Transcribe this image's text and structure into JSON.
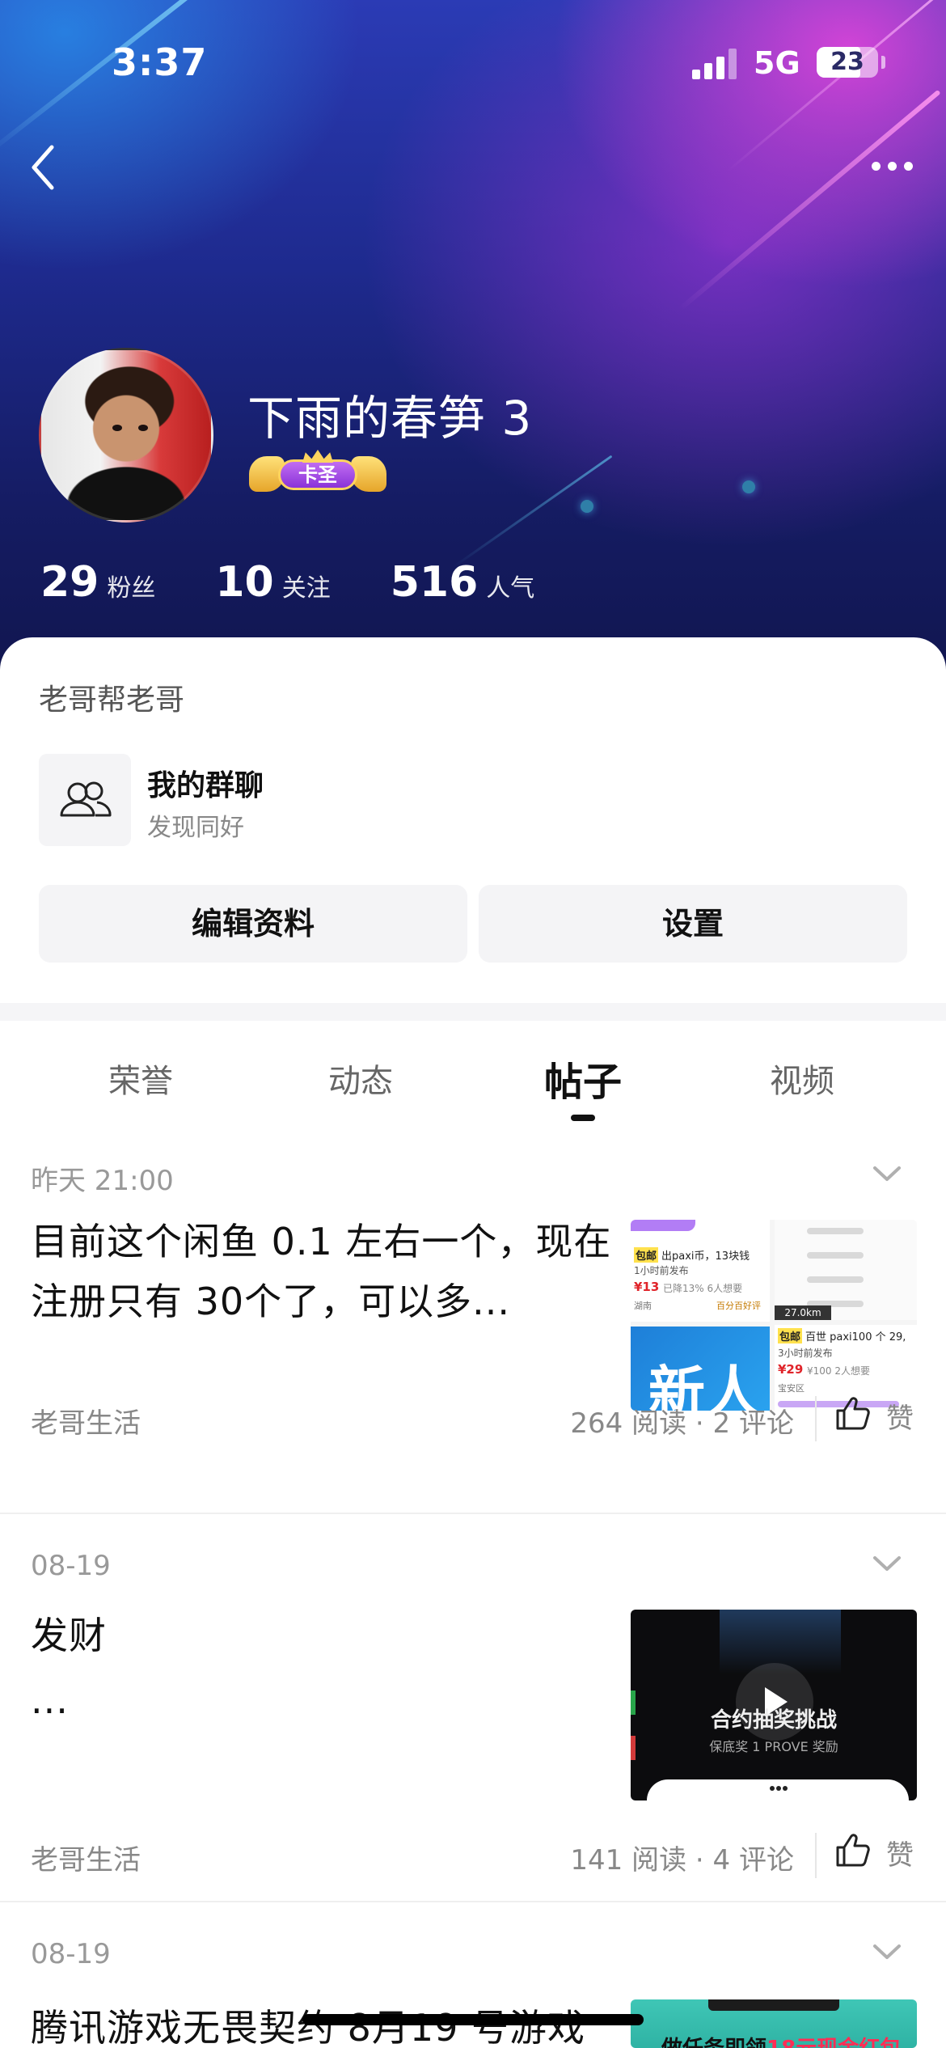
{
  "status_bar": {
    "time": "3:37",
    "network": "5G",
    "battery": "23"
  },
  "header": {
    "username": "下雨的春笋 3",
    "level_badge": "卡圣",
    "stats": [
      {
        "value": "29",
        "label": "粉丝"
      },
      {
        "value": "10",
        "label": "关注"
      },
      {
        "value": "516",
        "label": "人气"
      }
    ]
  },
  "profile": {
    "bio": "老哥帮老哥",
    "group": {
      "title": "我的群聊",
      "subtitle": "发现同好"
    },
    "buttons": {
      "edit": "编辑资料",
      "settings": "设置"
    }
  },
  "tabs": [
    {
      "label": "荣誉",
      "active": false
    },
    {
      "label": "动态",
      "active": false
    },
    {
      "label": "帖子",
      "active": true
    },
    {
      "label": "视频",
      "active": false
    }
  ],
  "posts": [
    {
      "date": "昨天 21:00",
      "title": "目前这个闲鱼 0.1 左右一个，现在注册只有 30个了，可以多...",
      "forum": "老哥生活",
      "meta": "264 阅读 · 2 评论",
      "like_label": "赞",
      "thumb": {
        "l1": "包邮",
        "l1b": "出paxi币，13块钱",
        "l2": "1小时前发布",
        "p1": "¥13",
        "p1b": "已降13%  6人想要",
        "loc1": "湖南",
        "tag1": "百分百好评",
        "l3": "包邮",
        "l3b": "百世 paxi100 个 29,",
        "l4": "3小时前发布",
        "p2": "¥29",
        "p2b": "¥100  2人想要",
        "loc2": "宝安区",
        "dur": "27.0km",
        "new_label": "新人"
      }
    },
    {
      "date": "08-19",
      "title": "发财\n...",
      "forum": "老哥生活",
      "meta": "141 阅读 · 4 评论",
      "like_label": "赞",
      "thumb": {
        "cap1": "合约抽奖挑战",
        "cap2": "保底奖 1 PROVE 奖励"
      }
    },
    {
      "date": "08-19",
      "title": "腾讯游戏无畏契约 8月19 号游戏",
      "thumb": {
        "text_a": "做任务即领",
        "text_b": "18元现金红包"
      }
    }
  ],
  "colors": {
    "accent": "#111111",
    "banner_top": "#2b3bb5",
    "banner_pink": "#eb46dc",
    "price_red": "#e0242a"
  }
}
